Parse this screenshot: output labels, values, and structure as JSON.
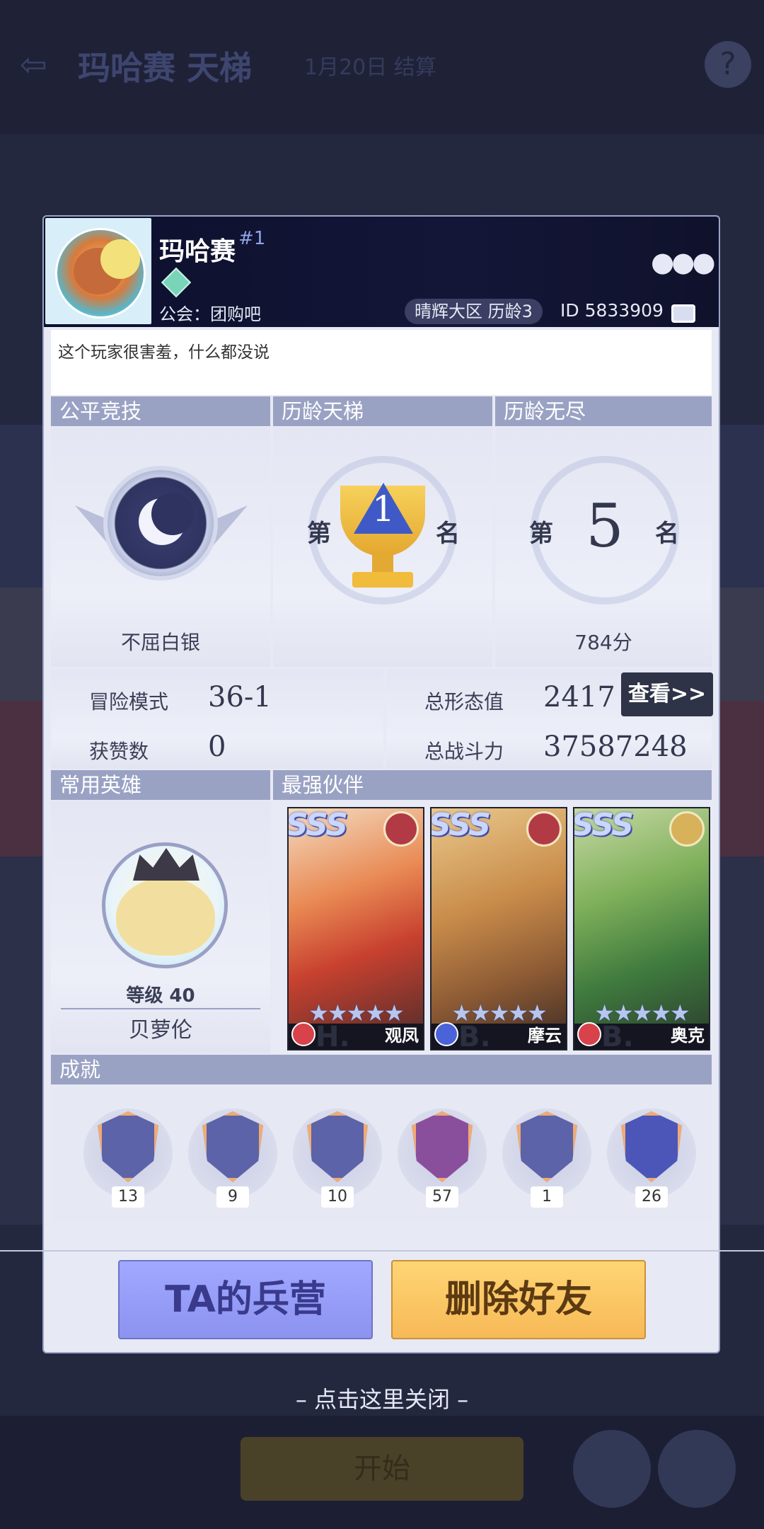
{
  "background": {
    "title": "玛哈赛 天梯",
    "subtitle": "1月20日 结算",
    "back_icon": "back-arrow-icon",
    "help_icon": "question-icon"
  },
  "player": {
    "name": "玛哈赛",
    "rank_tag": "#1",
    "guild": "公会：团购吧",
    "server": "晴辉大区  历龄3",
    "id": "ID 5833909",
    "signature": "这个玩家很害羞，什么都没说"
  },
  "sections": {
    "fair": {
      "title": "公平竞技",
      "label": "不屈白银"
    },
    "ladder": {
      "title": "历龄天梯",
      "pre": "第",
      "num": "1",
      "post": "名"
    },
    "endless": {
      "title": "历龄无尽",
      "pre": "第",
      "num": "5",
      "post": "名",
      "score": "784分"
    }
  },
  "stats": {
    "adventure_label": "冒险模式",
    "adventure_value": "36-1",
    "likes_label": "获赞数",
    "likes_value": "0",
    "form_label": "总形态值",
    "form_value": "2417",
    "power_label": "总战斗力",
    "power_value": "37587248",
    "view_button": "查看>>"
  },
  "common_hero": {
    "title": "常用英雄",
    "level": "等级 40",
    "name": "贝萝伦"
  },
  "partners": {
    "title": "最强伙伴",
    "cards": [
      {
        "grade": "SSS",
        "tier": "H.",
        "name": "观凤",
        "stars": "★★★★★"
      },
      {
        "grade": "SSS",
        "tier": "B.",
        "name": "摩云",
        "stars": "★★★★★"
      },
      {
        "grade": "SSS",
        "tier": "B.",
        "name": "奥克",
        "stars": "★★★★★"
      }
    ]
  },
  "achievements": {
    "title": "成就",
    "items": [
      {
        "count": "13"
      },
      {
        "count": "9"
      },
      {
        "count": "10"
      },
      {
        "count": "57"
      },
      {
        "count": "1"
      },
      {
        "count": "26"
      }
    ]
  },
  "buttons": {
    "barracks": "TA的兵营",
    "remove_friend": "删除好友"
  },
  "close_hint": "– 点击这里关闭 –",
  "colors": {
    "section_header": "#9aa2c4",
    "blue_button": "#9aa0fb",
    "gold_button": "#fbc865"
  }
}
